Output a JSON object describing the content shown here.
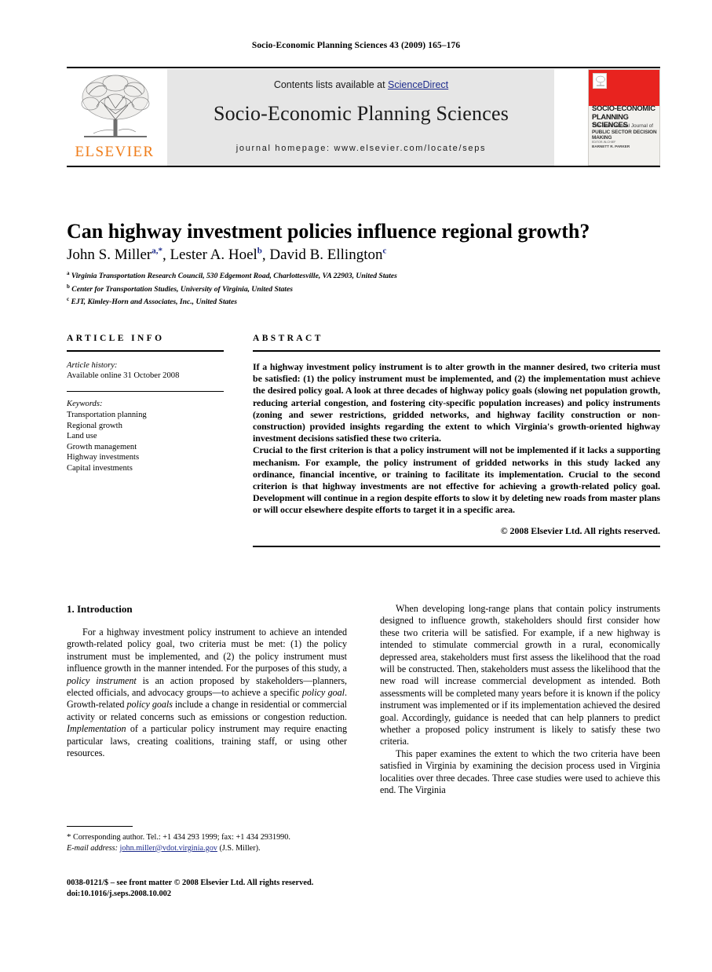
{
  "running_head": "Socio-Economic Planning Sciences 43 (2009) 165–176",
  "masthead": {
    "contents_prefix": "Contents lists available at ",
    "sciencedirect": "ScienceDirect",
    "journal_title": "Socio-Economic Planning Sciences",
    "homepage": "journal homepage: www.elsevier.com/locate/seps",
    "publisher_name": "ELSEVIER",
    "accent_orange": "#ef7d1a",
    "link_blue": "#1d2b8c",
    "band_gray": "#e6e6e6"
  },
  "cover": {
    "title_line1": "SOCIO-ECONOMIC",
    "title_line2": "PLANNING SCIENCES",
    "subtitle_line1": "The International Journal of",
    "subtitle_line2": "PUBLIC SECTOR DECISION MAKING",
    "editor_label": "EDITOR-IN-CHIEF",
    "editor_name": "BARNETT R. PARKER",
    "red": "#e8231f"
  },
  "article": {
    "title": "Can highway investment policies influence regional growth?",
    "authors": [
      {
        "name": "John S. Miller",
        "marks": "a,*"
      },
      {
        "name": "Lester A. Hoel",
        "marks": "b"
      },
      {
        "name": "David B. Ellington",
        "marks": "c"
      }
    ],
    "affiliations": [
      {
        "mark": "a",
        "text": "Virginia Transportation Research Council, 530 Edgemont Road, Charlottesville, VA 22903, United States"
      },
      {
        "mark": "b",
        "text": "Center for Transportation Studies, University of Virginia, United States"
      },
      {
        "mark": "c",
        "text": "EJT, Kimley-Horn and Associates, Inc., United States"
      }
    ]
  },
  "article_info": {
    "heading": "ARTICLE INFO",
    "history_label": "Article history:",
    "history_value": "Available online 31 October 2008",
    "keywords_label": "Keywords:",
    "keywords": [
      "Transportation planning",
      "Regional growth",
      "Land use",
      "Growth management",
      "Highway investments",
      "Capital investments"
    ]
  },
  "abstract": {
    "heading": "ABSTRACT",
    "paragraphs": [
      "If a highway investment policy instrument is to alter growth in the manner desired, two criteria must be satisfied: (1) the policy instrument must be implemented, and (2) the implementation must achieve the desired policy goal. A look at three decades of highway policy goals (slowing net population growth, reducing arterial congestion, and fostering city-specific population increases) and policy instruments (zoning and sewer restrictions, gridded networks, and highway facility construction or non-construction) provided insights regarding the extent to which Virginia's growth-oriented highway investment decisions satisfied these two criteria.",
      "Crucial to the first criterion is that a policy instrument will not be implemented if it lacks a supporting mechanism. For example, the policy instrument of gridded networks in this study lacked any ordinance, financial incentive, or training to facilitate its implementation. Crucial to the second criterion is that highway investments are not effective for achieving a growth-related policy goal. Development will continue in a region despite efforts to slow it by deleting new roads from master plans or will occur elsewhere despite efforts to target it in a specific area."
    ],
    "copyright": "© 2008 Elsevier Ltd. All rights reserved."
  },
  "body": {
    "section_heading": "1. Introduction",
    "left_paragraphs": [
      "For a highway investment policy instrument to achieve an intended growth-related policy goal, two criteria must be met: (1) the policy instrument must be implemented, and (2) the policy instrument must influence growth in the manner intended. For the purposes of this study, a <i>policy instrument</i> is an action proposed by stakeholders—planners, elected officials, and advocacy groups—to achieve a specific <i>policy goal</i>. Growth-related <i>policy goals</i> include a change in residential or commercial activity or related concerns such as emissions or congestion reduction. <i>Implementation</i> of a particular policy instrument may require enacting particular laws, creating coalitions, training staff, or using other resources."
    ],
    "right_paragraphs": [
      "When developing long-range plans that contain policy instruments designed to influence growth, stakeholders should first consider how these two criteria will be satisfied. For example, if a new highway is intended to stimulate commercial growth in a rural, economically depressed area, stakeholders must first assess the likelihood that the road will be constructed. Then, stakeholders must assess the likelihood that the new road will increase commercial development as intended. Both assessments will be completed many years before it is known if the policy instrument was implemented or if its implementation achieved the desired goal. Accordingly, guidance is needed that can help planners to predict whether a proposed policy instrument is likely to satisfy these two criteria.",
      "This paper examines the extent to which the two criteria have been satisfied in Virginia by examining the decision process used in Virginia localities over three decades. Three case studies were used to achieve this end. The Virginia"
    ]
  },
  "footnote": {
    "star": "*",
    "corresponding": "Corresponding author. Tel.: +1 434 293 1999; fax: +1 434 2931990.",
    "email_label": "E-mail address:",
    "email": "john.miller@vdot.virginia.gov",
    "email_suffix": "(J.S. Miller)."
  },
  "footer": {
    "line1": "0038-0121/$ – see front matter © 2008 Elsevier Ltd. All rights reserved.",
    "line2": "doi:10.1016/j.seps.2008.10.002"
  }
}
